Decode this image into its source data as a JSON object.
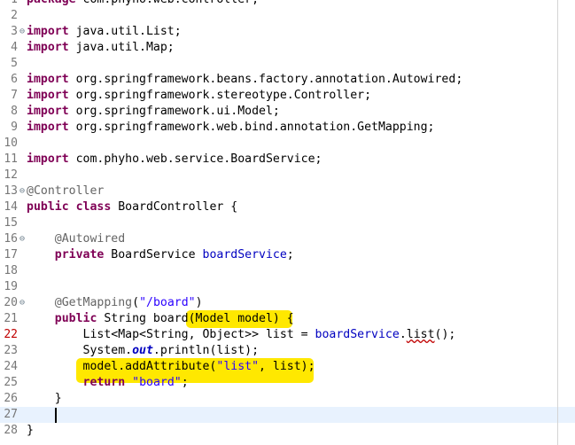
{
  "editor": {
    "lines": [
      {
        "num": "1",
        "fold": "",
        "error": false,
        "current": false,
        "tokens": [
          {
            "t": "package com.phyho.web.controller;",
            "c": "kw-partial"
          }
        ]
      },
      {
        "num": "2",
        "fold": "",
        "error": false,
        "current": false,
        "tokens": []
      },
      {
        "num": "3",
        "fold": "⊖",
        "error": false,
        "current": false,
        "tokens": [
          {
            "t": "import",
            "c": "kw"
          },
          {
            "t": " java.util.List;",
            "c": ""
          }
        ]
      },
      {
        "num": "4",
        "fold": "",
        "error": false,
        "current": false,
        "tokens": [
          {
            "t": "import",
            "c": "kw"
          },
          {
            "t": " java.util.Map;",
            "c": ""
          }
        ]
      },
      {
        "num": "5",
        "fold": "",
        "error": false,
        "current": false,
        "tokens": []
      },
      {
        "num": "6",
        "fold": "",
        "error": false,
        "current": false,
        "tokens": [
          {
            "t": "import",
            "c": "kw"
          },
          {
            "t": " org.springframework.beans.factory.annotation.Autowired;",
            "c": ""
          }
        ]
      },
      {
        "num": "7",
        "fold": "",
        "error": false,
        "current": false,
        "tokens": [
          {
            "t": "import",
            "c": "kw"
          },
          {
            "t": " org.springframework.stereotype.Controller;",
            "c": ""
          }
        ]
      },
      {
        "num": "8",
        "fold": "",
        "error": false,
        "current": false,
        "tokens": [
          {
            "t": "import",
            "c": "kw"
          },
          {
            "t": " org.springframework.ui.Model;",
            "c": ""
          }
        ]
      },
      {
        "num": "9",
        "fold": "",
        "error": false,
        "current": false,
        "tokens": [
          {
            "t": "import",
            "c": "kw"
          },
          {
            "t": " org.springframework.web.bind.annotation.GetMapping;",
            "c": ""
          }
        ]
      },
      {
        "num": "10",
        "fold": "",
        "error": false,
        "current": false,
        "tokens": []
      },
      {
        "num": "11",
        "fold": "",
        "error": false,
        "current": false,
        "tokens": [
          {
            "t": "import",
            "c": "kw"
          },
          {
            "t": " com.phyho.web.service.BoardService;",
            "c": ""
          }
        ]
      },
      {
        "num": "12",
        "fold": "",
        "error": false,
        "current": false,
        "tokens": []
      },
      {
        "num": "13",
        "fold": "⊖",
        "error": false,
        "current": false,
        "tokens": [
          {
            "t": "@Controller",
            "c": "an"
          }
        ]
      },
      {
        "num": "14",
        "fold": "",
        "error": false,
        "current": false,
        "tokens": [
          {
            "t": "public",
            "c": "kw"
          },
          {
            "t": " ",
            "c": ""
          },
          {
            "t": "class",
            "c": "kw"
          },
          {
            "t": " BoardController {",
            "c": ""
          }
        ]
      },
      {
        "num": "15",
        "fold": "",
        "error": false,
        "current": false,
        "tokens": []
      },
      {
        "num": "16",
        "fold": "⊖",
        "error": false,
        "current": false,
        "tokens": [
          {
            "t": "    ",
            "c": ""
          },
          {
            "t": "@Autowired",
            "c": "an"
          }
        ]
      },
      {
        "num": "17",
        "fold": "",
        "error": false,
        "current": false,
        "tokens": [
          {
            "t": "    ",
            "c": ""
          },
          {
            "t": "private",
            "c": "kw"
          },
          {
            "t": " BoardService ",
            "c": ""
          },
          {
            "t": "boardService",
            "c": "fld"
          },
          {
            "t": ";",
            "c": ""
          }
        ]
      },
      {
        "num": "18",
        "fold": "",
        "error": false,
        "current": false,
        "tokens": []
      },
      {
        "num": "19",
        "fold": "",
        "error": false,
        "current": false,
        "tokens": []
      },
      {
        "num": "20",
        "fold": "⊖",
        "error": false,
        "current": false,
        "tokens": [
          {
            "t": "    ",
            "c": ""
          },
          {
            "t": "@GetMapping",
            "c": "an"
          },
          {
            "t": "(",
            "c": ""
          },
          {
            "t": "\"/board\"",
            "c": "str"
          },
          {
            "t": ")",
            "c": ""
          }
        ]
      },
      {
        "num": "21",
        "fold": "",
        "error": false,
        "current": false,
        "tokens": [
          {
            "t": "    ",
            "c": ""
          },
          {
            "t": "public",
            "c": "kw"
          },
          {
            "t": " String board(Model model) {",
            "c": ""
          }
        ]
      },
      {
        "num": "22",
        "fold": "",
        "error": true,
        "current": false,
        "tokens": [
          {
            "t": "        List<Map<String, Object>> list = ",
            "c": ""
          },
          {
            "t": "boardService",
            "c": "fld"
          },
          {
            "t": ".",
            "c": ""
          },
          {
            "t": "list",
            "c": "wavy"
          },
          {
            "t": "();",
            "c": ""
          }
        ]
      },
      {
        "num": "23",
        "fold": "",
        "error": false,
        "current": false,
        "tokens": [
          {
            "t": "        System.",
            "c": ""
          },
          {
            "t": "out",
            "c": "ita"
          },
          {
            "t": ".println(list);",
            "c": ""
          }
        ]
      },
      {
        "num": "24",
        "fold": "",
        "error": false,
        "current": false,
        "tokens": [
          {
            "t": "        model.addAttribute(",
            "c": ""
          },
          {
            "t": "\"list\"",
            "c": "str"
          },
          {
            "t": ", list);",
            "c": ""
          }
        ]
      },
      {
        "num": "25",
        "fold": "",
        "error": false,
        "current": false,
        "tokens": [
          {
            "t": "        ",
            "c": ""
          },
          {
            "t": "return",
            "c": "kw"
          },
          {
            "t": " ",
            "c": ""
          },
          {
            "t": "\"board\"",
            "c": "str"
          },
          {
            "t": ";",
            "c": ""
          }
        ]
      },
      {
        "num": "26",
        "fold": "",
        "error": false,
        "current": false,
        "tokens": [
          {
            "t": "    }",
            "c": ""
          }
        ]
      },
      {
        "num": "27",
        "fold": "",
        "error": false,
        "current": true,
        "tokens": []
      },
      {
        "num": "28",
        "fold": "",
        "error": false,
        "current": false,
        "tokens": [
          {
            "t": "}",
            "c": ""
          }
        ]
      }
    ]
  },
  "colors": {
    "keyword": "#7f0055",
    "annotation": "#646464",
    "string": "#2a00ff",
    "field": "#0000c0",
    "highlighter": "#ffe800",
    "current_line": "#e8f2fe"
  }
}
